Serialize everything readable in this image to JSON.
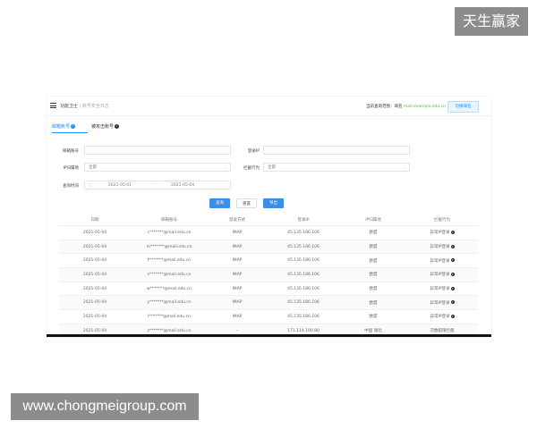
{
  "watermarks": {
    "top_right": "天生赢家",
    "bottom_left": "www.chongmeigroup.com"
  },
  "app": {
    "breadcrumb": [
      "功能卫士",
      "/",
      "账号安全日志"
    ],
    "current_site_label": "当前查询范围：域名",
    "current_site_domain": "mail.example.edu.cn",
    "switch_button": "切换域名"
  },
  "tabs": [
    {
      "label": "邮箱账号",
      "icon": "i",
      "active": true
    },
    {
      "label": "被攻击账号",
      "icon": "i",
      "active": false
    }
  ],
  "filters": {
    "email_account_label": "邮箱账号",
    "email_account_value": "",
    "login_ip_label": "登录IP",
    "login_ip_value": "",
    "ip_region_label": "IP归属地",
    "ip_region_value": "全部",
    "protection_label": "拦截行为",
    "protection_value": "全部",
    "query_time_label": "查询时间",
    "date_from": "2021-05-01",
    "date_sep": "-",
    "date_to": "2021-05-04"
  },
  "buttons": {
    "query": "查询",
    "reset": "重置",
    "export": "导出"
  },
  "table": {
    "columns": [
      "日期",
      "邮箱账号",
      "登录方式",
      "登录IP",
      "IP归属地",
      "拦截行为"
    ],
    "rows": [
      [
        "2021-05-04",
        "c*******@mail.edu.cn",
        "IMAP",
        "45.135.186.106",
        "欧盟",
        "异常IP登录"
      ],
      [
        "2021-05-04",
        "m*******@mail.edu.cn",
        "IMAP",
        "45.135.186.106",
        "欧盟",
        "异常IP登录"
      ],
      [
        "2021-05-04",
        "t*******@mail.edu.cn",
        "IMAP",
        "45.135.186.106",
        "欧盟",
        "异常IP登录"
      ],
      [
        "2021-05-04",
        "s*******@mail.edu.cn",
        "IMAP",
        "45.135.186.106",
        "欧盟",
        "异常IP登录"
      ],
      [
        "2021-05-04",
        "w*******@mail.edu.cn",
        "IMAP",
        "45.135.186.106",
        "欧盟",
        "异常IP登录"
      ],
      [
        "2021-05-04",
        "y*******@mail.edu.cn",
        "IMAP",
        "45.135.186.106",
        "欧盟",
        "异常IP登录"
      ],
      [
        "2021-05-04",
        "l*******@mail.edu.cn",
        "IMAP",
        "45.135.186.106",
        "欧盟",
        "异常IP登录"
      ],
      [
        "2021-05-04",
        "z*******@mail.edu.cn",
        "--",
        "171.114.100.80",
        "中国 湖北",
        "次数超限拦截"
      ]
    ]
  }
}
